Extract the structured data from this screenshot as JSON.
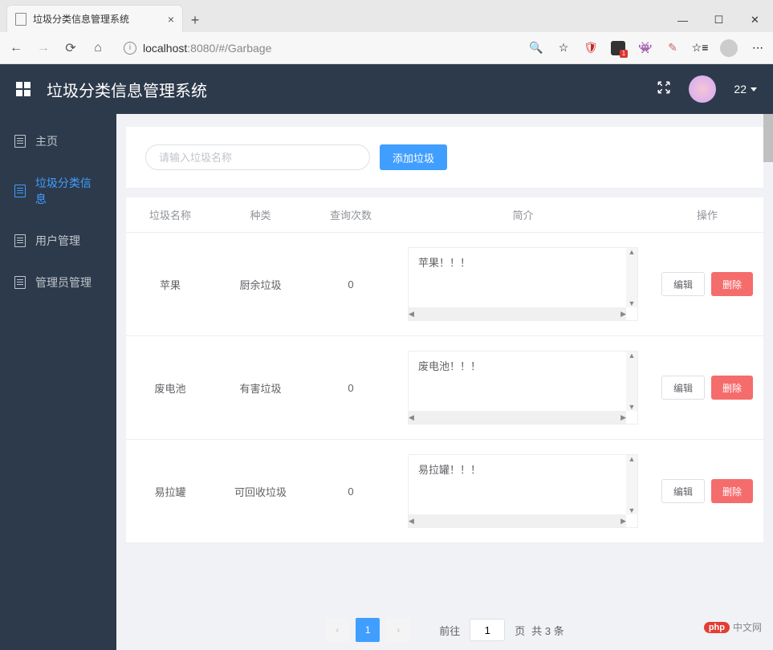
{
  "browser": {
    "tab_title": "垃圾分类信息管理系统",
    "url_host": "localhost",
    "url_port": ":8080",
    "url_path": "/#/Garbage"
  },
  "header": {
    "app_title": "垃圾分类信息管理系统",
    "user_badge": "22"
  },
  "sidebar": {
    "items": [
      {
        "label": "主页"
      },
      {
        "label": "垃圾分类信息"
      },
      {
        "label": "用户管理"
      },
      {
        "label": "管理员管理"
      }
    ]
  },
  "search": {
    "placeholder": "请输入垃圾名称",
    "add_button": "添加垃圾"
  },
  "table": {
    "headers": {
      "name": "垃圾名称",
      "kind": "种类",
      "count": "查询次数",
      "intro": "简介",
      "op": "操作"
    },
    "rows": [
      {
        "name": "苹果",
        "kind": "厨余垃圾",
        "count": "0",
        "intro": "苹果！！！"
      },
      {
        "name": "废电池",
        "kind": "有害垃圾",
        "count": "0",
        "intro": "废电池！！！"
      },
      {
        "name": "易拉罐",
        "kind": "可回收垃圾",
        "count": "0",
        "intro": "易拉罐！！！"
      }
    ],
    "edit_label": "编辑",
    "delete_label": "删除"
  },
  "pagination": {
    "current": "1",
    "goto_prefix": "前往",
    "goto_value": "1",
    "goto_suffix": "页",
    "total_text": "共 3 条"
  },
  "watermark": {
    "brand": "php",
    "text": "中文网"
  }
}
